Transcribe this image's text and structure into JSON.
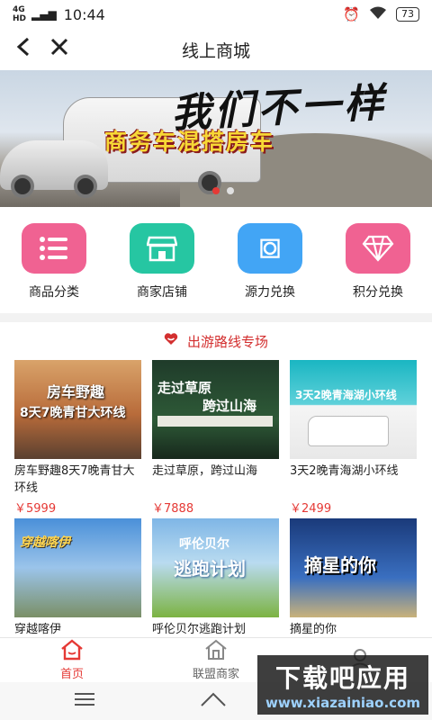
{
  "status_bar": {
    "signal": "4G",
    "signal_sub": "HD",
    "time": "10:44",
    "battery": "73"
  },
  "nav": {
    "title": "线上商城"
  },
  "banner": {
    "slogan_main": "我们不一样",
    "slogan_sub": "商务车混搭房车",
    "slides": 2,
    "active_slide": 1
  },
  "menu": [
    {
      "label": "商品分类",
      "icon": "list-icon",
      "color": "#f06292"
    },
    {
      "label": "商家店铺",
      "icon": "store-icon",
      "color": "#26c6a2"
    },
    {
      "label": "源力兑换",
      "icon": "exchange-tag-icon",
      "color": "#42a5f5"
    },
    {
      "label": "积分兑换",
      "icon": "diamond-icon",
      "color": "#f06292"
    }
  ],
  "section": {
    "title": "出游路线专场",
    "icon": "heart-icon"
  },
  "products": [
    {
      "name": "房车野趣8天7晚青甘大环线",
      "price": "￥5999",
      "thumb_text": [
        "房车野趣",
        "8天7晚青甘大环线"
      ]
    },
    {
      "name": "走过草原，跨过山海",
      "price": "￥7888",
      "thumb_text": [
        "走过草原",
        "跨过山海"
      ]
    },
    {
      "name": "3天2晚青海湖小环线",
      "price": "￥2499",
      "thumb_text": [
        "3天2晚青海湖小环线"
      ]
    },
    {
      "name": "穿越喀伊",
      "price": "",
      "thumb_text": [
        "穿越喀伊"
      ]
    },
    {
      "name": "呼伦贝尔逃跑计划",
      "price": "",
      "thumb_text": [
        "呼伦贝尔",
        "逃跑计划"
      ]
    },
    {
      "name": "摘星的你",
      "price": "",
      "thumb_text": [
        "摘星的你"
      ]
    }
  ],
  "tabbar": [
    {
      "label": "首页",
      "icon": "home-icon",
      "active": true
    },
    {
      "label": "联盟商家",
      "icon": "shop-house-icon",
      "active": false
    },
    {
      "label": "",
      "icon": "user-icon",
      "active": false
    }
  ],
  "watermark": {
    "line1": "下载吧应用",
    "line2": "www.xiazainiao.com"
  },
  "colors": {
    "accent": "#e53935",
    "price": "#e53935"
  }
}
